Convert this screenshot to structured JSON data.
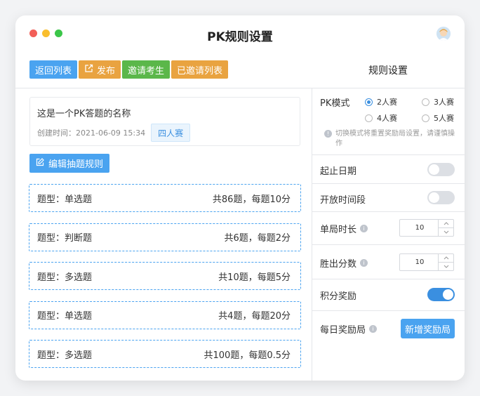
{
  "window": {
    "title": "PK规则设置"
  },
  "toolbar": {
    "back_label": "返回列表",
    "publish_label": "发布",
    "invite_label": "邀请考生",
    "invited_list_label": "已邀请列表"
  },
  "rules_panel": {
    "title": "规则设置"
  },
  "info": {
    "name": "这是一个PK答题的名称",
    "created": "创建时间：2021-06-09  15:34",
    "badge": "四人赛"
  },
  "edit_button": "编辑抽题规则",
  "questions": [
    {
      "type": "题型：单选题",
      "count": "共86题，每题10分"
    },
    {
      "type": "题型：判断题",
      "count": "共6题，每题2分"
    },
    {
      "type": "题型：多选题",
      "count": "共10题，每题5分"
    },
    {
      "type": "题型：单选题",
      "count": "共4题，每题20分"
    },
    {
      "type": "题型：多选题",
      "count": "共100题，每题0.5分"
    }
  ],
  "settings": {
    "mode_label": "PK模式",
    "mode_options": [
      "2人赛",
      "3人赛",
      "4人赛",
      "5人赛"
    ],
    "mode_selected": "2人赛",
    "mode_hint": "切换模式将重置奖励局设置，请谨慎操作",
    "date_label": "起止日期",
    "date_enabled": false,
    "open_time_label": "开放时间段",
    "open_time_enabled": false,
    "round_time_label": "单局时长",
    "round_time_value": "10",
    "win_score_label": "胜出分数",
    "win_score_value": "10",
    "points_reward_label": "积分奖励",
    "points_reward_enabled": true,
    "daily_reward_label": "每日奖励局",
    "add_reward_label": "新增奖励局"
  },
  "colors": {
    "primary": "#4aa3f0",
    "orange": "#e9a340",
    "green": "#5bb74a"
  }
}
